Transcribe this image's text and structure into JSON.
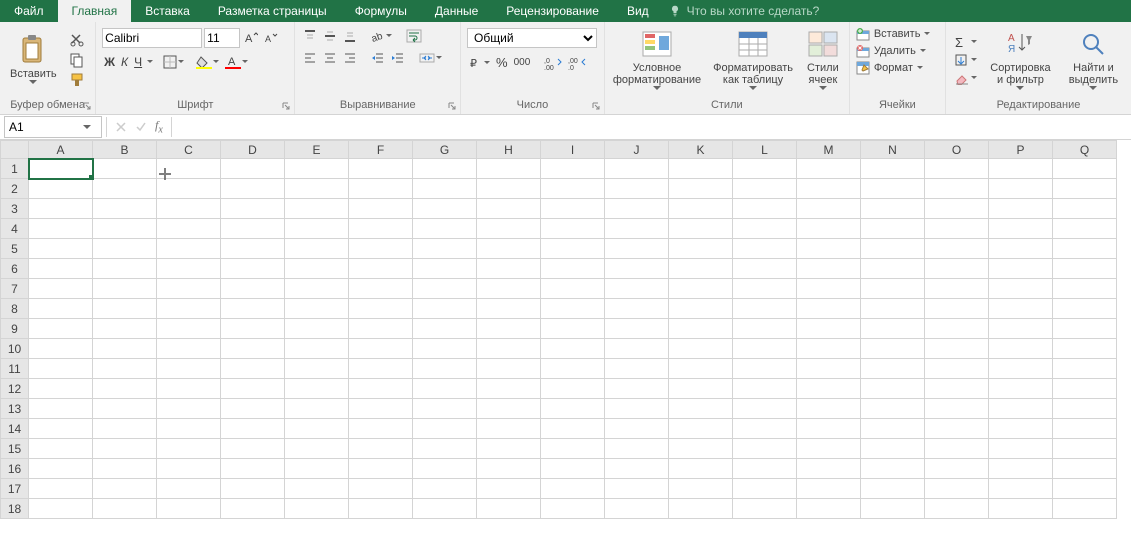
{
  "tabs": {
    "file": "Файл",
    "home": "Главная",
    "insert": "Вставка",
    "layout": "Разметка страницы",
    "formulas": "Формулы",
    "data": "Данные",
    "review": "Рецензирование",
    "view": "Вид",
    "tellme": "Что вы хотите сделать?"
  },
  "clipboard": {
    "paste": "Вставить",
    "group": "Буфер обмена"
  },
  "font": {
    "name": "Calibri",
    "size": "11",
    "group": "Шрифт",
    "bold": "Ж",
    "italic": "К",
    "underline": "Ч"
  },
  "alignment": {
    "group": "Выравнивание"
  },
  "number": {
    "format": "Общий",
    "group": "Число",
    "percent": "%",
    "thousands": "000"
  },
  "styles": {
    "cond": "Условное форматирование",
    "table": "Форматировать как таблицу",
    "cell": "Стили ячеек",
    "group": "Стили"
  },
  "cells": {
    "insert": "Вставить",
    "delete": "Удалить",
    "format": "Формат",
    "group": "Ячейки"
  },
  "editing": {
    "sort": "Сортировка и фильтр",
    "find": "Найти и выделить",
    "group": "Редактирование"
  },
  "namebox": "A1",
  "columns": [
    "A",
    "B",
    "C",
    "D",
    "E",
    "F",
    "G",
    "H",
    "I",
    "J",
    "K",
    "L",
    "M",
    "N",
    "O",
    "P",
    "Q"
  ],
  "rows": [
    "1",
    "2",
    "3",
    "4",
    "5",
    "6",
    "7",
    "8",
    "9",
    "10",
    "11",
    "12",
    "13",
    "14",
    "15",
    "16",
    "17",
    "18"
  ]
}
